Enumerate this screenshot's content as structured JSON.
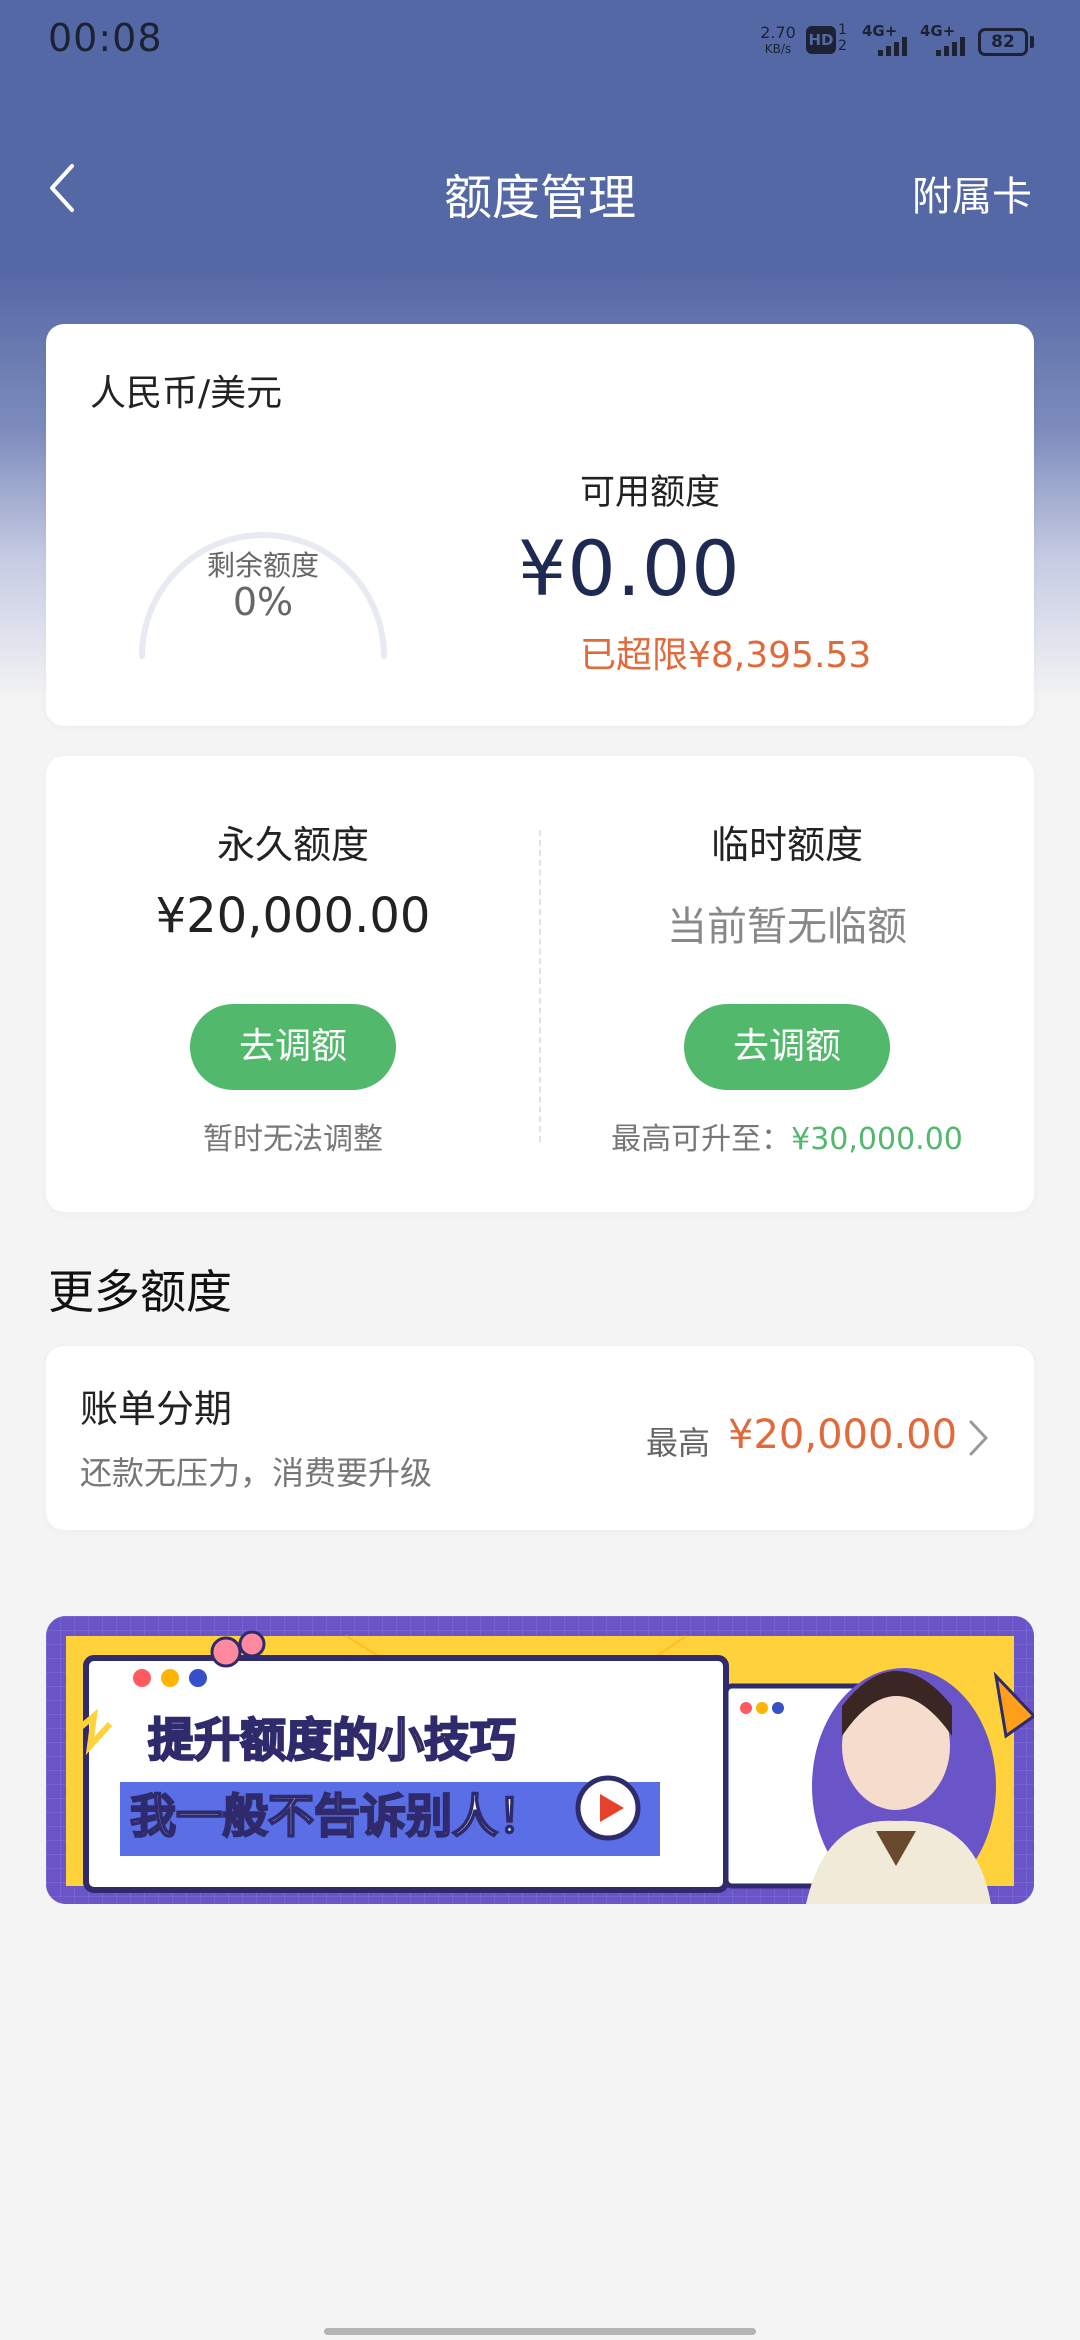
{
  "status_bar": {
    "time": "00:08",
    "speed_value": "2.70",
    "speed_unit": "KB/s",
    "hd": "HD",
    "hd_sub_1": "1",
    "hd_sub_2": "2",
    "network_1": "4G+",
    "network_2": "4G+",
    "battery": "82"
  },
  "nav": {
    "title": "额度管理",
    "right_action": "附属卡"
  },
  "summary": {
    "currency": "人民币/美元",
    "remaining_label": "剩余额度",
    "remaining_percent": "0%",
    "available_label": "可用额度",
    "available_amount": "¥0.00",
    "over_limit": "已超限¥8,395.53"
  },
  "limits": {
    "permanent": {
      "title": "永久额度",
      "amount": "¥20,000.00",
      "button": "去调额",
      "note": "暂时无法调整"
    },
    "temporary": {
      "title": "临时额度",
      "amount": "当前暂无临额",
      "button": "去调额",
      "note_prefix": "最高可升至：",
      "note_amount": "¥30,000.00"
    }
  },
  "more": {
    "section_title": "更多额度",
    "installment": {
      "title": "账单分期",
      "subtitle": "还款无压力，消费要升级",
      "prefix": "最高",
      "amount": "¥20,000.00"
    }
  },
  "banner": {
    "line1": "提升额度的小技巧",
    "line2": "我一般不告诉别人！"
  },
  "colors": {
    "header": "#5568a6",
    "green": "#52b86c",
    "orange": "#e06a3a",
    "navy": "#1e2a52"
  }
}
